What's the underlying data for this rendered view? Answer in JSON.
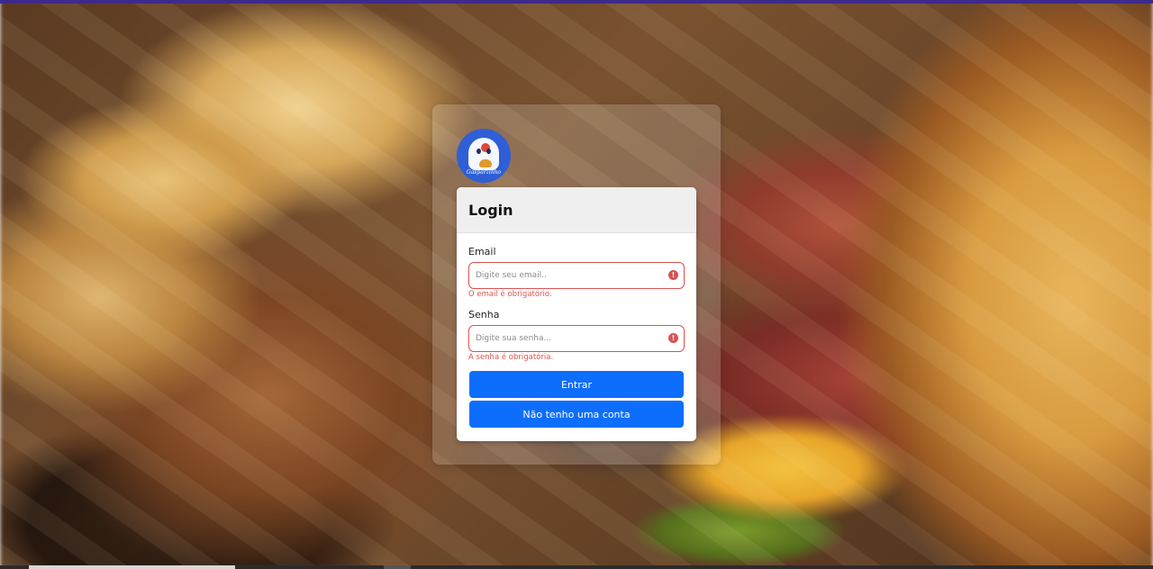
{
  "login": {
    "title": "Login",
    "email_label": "Email",
    "email_placeholder": "Digite seu email..",
    "email_value": "",
    "email_error": "O email é obrigatório.",
    "password_label": "Senha",
    "password_placeholder": "Digite sua senha...",
    "password_value": "",
    "password_error": "A senha é obrigatória.",
    "submit_label": "Entrar",
    "register_label": "Não tenho uma conta"
  },
  "brand": {
    "logo_text": "Gasparzinho"
  },
  "icons": {
    "error": "exclamation-circle-icon",
    "logo": "ghost-burger-logo"
  },
  "colors": {
    "primary": "#0d6efd",
    "error": "#d9534f",
    "logo_bg": "#2f5fd6"
  }
}
